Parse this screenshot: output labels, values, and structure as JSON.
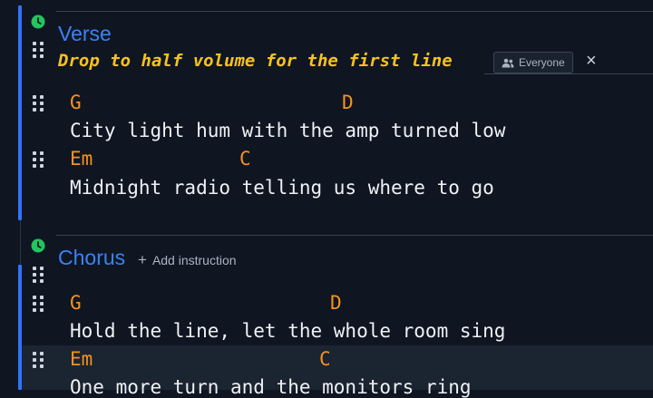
{
  "sections": [
    {
      "title": "Verse",
      "instruction": "Drop to half volume for the first line",
      "audience_badge": "Everyone",
      "lines": [
        {
          "chords": [
            {
              "name": "G"
            },
            {
              "name": "D"
            }
          ],
          "lyric": "City light hum with the amp turned low"
        },
        {
          "chords": [
            {
              "name": "Em"
            },
            {
              "name": "C"
            }
          ],
          "lyric": "Midnight radio telling us where to go"
        }
      ]
    },
    {
      "title": "Chorus",
      "add_instruction_label": "Add instruction",
      "lines": [
        {
          "chords": [
            {
              "name": "G"
            },
            {
              "name": "D"
            }
          ],
          "lyric": "Hold the line, let the whole room sing"
        },
        {
          "chords": [
            {
              "name": "Em"
            },
            {
              "name": "C"
            }
          ],
          "lyric": "One more turn and the monitors ring"
        }
      ]
    }
  ],
  "colors": {
    "background": "#0f1622",
    "accent": "#2f74ff",
    "section_title": "#3b82f6",
    "instruction": "#f6c21d",
    "chord": "#f5921f",
    "clock_icon": "#22c55e"
  },
  "icons": [
    "clock-icon",
    "drag-handle-icon",
    "people-icon",
    "close-icon",
    "plus-icon"
  ]
}
